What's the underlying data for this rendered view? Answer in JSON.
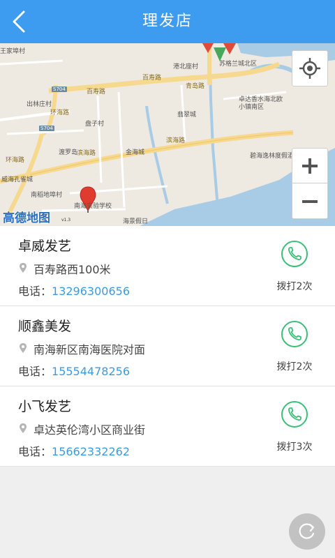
{
  "header": {
    "title": "理发店"
  },
  "map": {
    "logo": "高德地图",
    "version": "v1.3",
    "places": [
      "王家埠村",
      "港北座村",
      "苏格兰城北区",
      "卓达香水海北欧小镇南区",
      "出林庄村",
      "翡翠城",
      "盘子村",
      "渡罗岛",
      "金海城",
      "威海孔雀城",
      "南稻地埠村",
      "南海实验学校",
      "海景假日",
      "碧海逸林度假酒店"
    ],
    "roads": [
      "百寿路",
      "百寿路",
      "青岛路",
      "滨海路",
      "滨海路",
      "环海路",
      "环海路"
    ],
    "road_codes": [
      "S704",
      "S704"
    ]
  },
  "shops": [
    {
      "name": "卓威发艺",
      "address": "百寿路西100米",
      "phone_label": "电话：",
      "phone": "13296300656",
      "call_count": "拨打2次"
    },
    {
      "name": "顺鑫美发",
      "address": "南海新区南海医院对面",
      "phone_label": "电话：",
      "phone": "15554478256",
      "call_count": "拨打2次"
    },
    {
      "name": "小飞发艺",
      "address": "卓达英伦湾小区商业街",
      "phone_label": "电话：",
      "phone": "15662332262",
      "call_count": "拨打3次"
    }
  ],
  "colors": {
    "header": "#3d9bf0",
    "accent_green": "#3bbf78",
    "phone_blue": "#3a9be0"
  }
}
